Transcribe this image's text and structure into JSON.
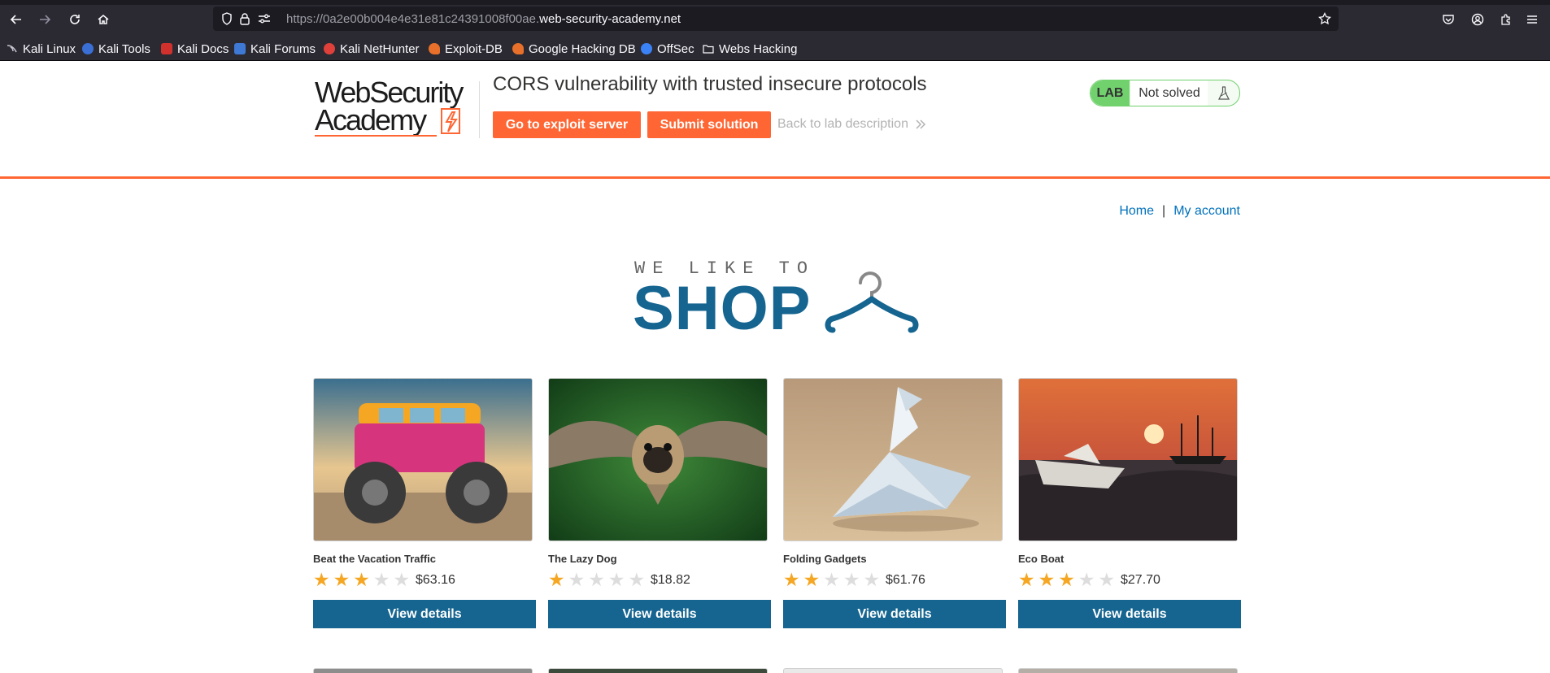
{
  "browser": {
    "url_prefix": "https://0a2e00b004e4e31e81c24391008f00ae.",
    "url_host": "web-security-academy.net",
    "bookmarks": [
      {
        "label": "Kali Linux",
        "color": "#367bf0"
      },
      {
        "label": "Kali Tools",
        "color": "#e04a5f"
      },
      {
        "label": "Kali Docs",
        "color": "#d0312d"
      },
      {
        "label": "Kali Forums",
        "color": "#3f79d6"
      },
      {
        "label": "Kali NetHunter",
        "color": "#e0403a"
      },
      {
        "label": "Exploit-DB",
        "color": "#e8702a"
      },
      {
        "label": "Google Hacking DB",
        "color": "#e8702a"
      },
      {
        "label": "OffSec",
        "color": "#3b82f6"
      },
      {
        "label": "Webs Hacking",
        "color": "#fbfbfe"
      }
    ]
  },
  "lab": {
    "logo_line1": "WebSecurity",
    "logo_line2": "Academy",
    "title": "CORS vulnerability with trusted insecure protocols",
    "exploit_button": "Go to exploit server",
    "submit_button": "Submit solution",
    "back_link": "Back to lab description",
    "status_badge": "LAB",
    "status_text": "Not solved"
  },
  "nav": {
    "home": "Home",
    "separator": "|",
    "account": "My account"
  },
  "hero": {
    "tagline": "WE LIKE TO",
    "shop": "SHOP"
  },
  "products": [
    {
      "name": "Beat the Vacation Traffic",
      "rating": 3,
      "price": "$63.16",
      "button": "View details"
    },
    {
      "name": "The Lazy Dog",
      "rating": 1,
      "price": "$18.82",
      "button": "View details"
    },
    {
      "name": "Folding Gadgets",
      "rating": 2,
      "price": "$61.76",
      "button": "View details"
    },
    {
      "name": "Eco Boat",
      "rating": 3,
      "price": "$27.70",
      "button": "View details"
    }
  ],
  "colors": {
    "accent_orange": "#ff6633",
    "brand_blue": "#156590",
    "link_blue": "#0071bc",
    "status_green": "#70d16d",
    "star_gold": "#f5a623"
  }
}
